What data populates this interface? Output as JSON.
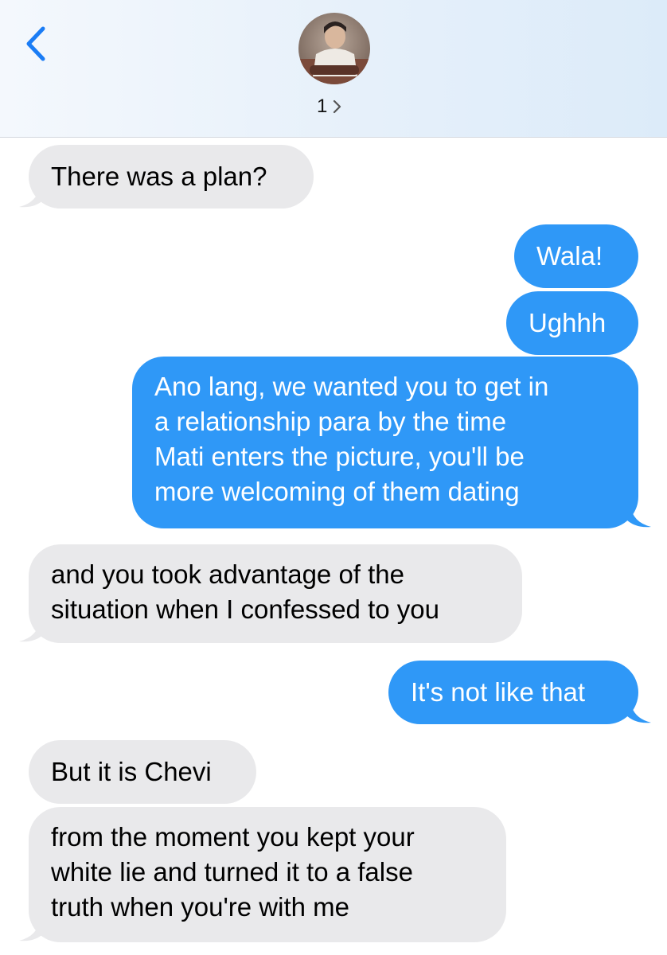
{
  "header": {
    "contact_count": "1",
    "colors": {
      "accent": "#1a7cf5"
    }
  },
  "messages": [
    {
      "direction": "incoming",
      "text": "There was a plan?"
    },
    {
      "direction": "outgoing",
      "text": "Wala!"
    },
    {
      "direction": "outgoing",
      "text": "Ughhh"
    },
    {
      "direction": "outgoing",
      "text": "Ano lang, we wanted you to get in\na relationship para by the time\nMati enters the picture, you'll be\nmore welcoming of them dating"
    },
    {
      "direction": "incoming",
      "text": "and you took advantage of the\nsituation when I confessed to you"
    },
    {
      "direction": "outgoing",
      "text": "It's not like that"
    },
    {
      "direction": "incoming",
      "text": "But it is Chevi"
    },
    {
      "direction": "incoming",
      "text": "from the moment you kept your\nwhite lie and turned it to a false\ntruth when you're with me"
    }
  ],
  "colors": {
    "incoming_bubble": "#e9e9eb",
    "outgoing_bubble": "#2f98f7"
  }
}
